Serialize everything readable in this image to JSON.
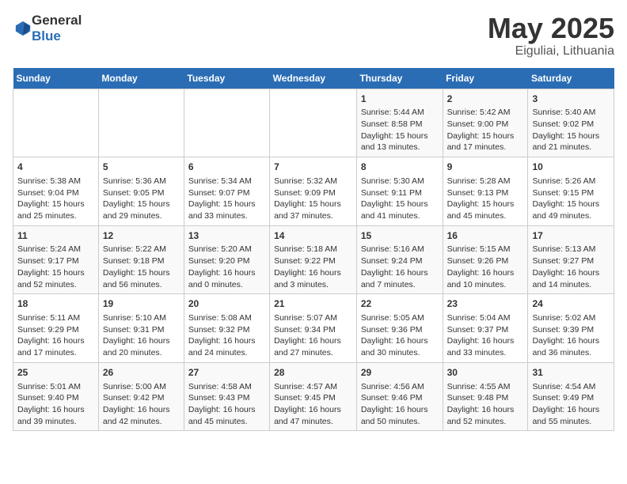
{
  "logo": {
    "general": "General",
    "blue": "Blue"
  },
  "title": "May 2025",
  "subtitle": "Eiguliai, Lithuania",
  "weekdays": [
    "Sunday",
    "Monday",
    "Tuesday",
    "Wednesday",
    "Thursday",
    "Friday",
    "Saturday"
  ],
  "weeks": [
    [
      {
        "day": "",
        "info": ""
      },
      {
        "day": "",
        "info": ""
      },
      {
        "day": "",
        "info": ""
      },
      {
        "day": "",
        "info": ""
      },
      {
        "day": "1",
        "info": "Sunrise: 5:44 AM\nSunset: 8:58 PM\nDaylight: 15 hours\nand 13 minutes."
      },
      {
        "day": "2",
        "info": "Sunrise: 5:42 AM\nSunset: 9:00 PM\nDaylight: 15 hours\nand 17 minutes."
      },
      {
        "day": "3",
        "info": "Sunrise: 5:40 AM\nSunset: 9:02 PM\nDaylight: 15 hours\nand 21 minutes."
      }
    ],
    [
      {
        "day": "4",
        "info": "Sunrise: 5:38 AM\nSunset: 9:04 PM\nDaylight: 15 hours\nand 25 minutes."
      },
      {
        "day": "5",
        "info": "Sunrise: 5:36 AM\nSunset: 9:05 PM\nDaylight: 15 hours\nand 29 minutes."
      },
      {
        "day": "6",
        "info": "Sunrise: 5:34 AM\nSunset: 9:07 PM\nDaylight: 15 hours\nand 33 minutes."
      },
      {
        "day": "7",
        "info": "Sunrise: 5:32 AM\nSunset: 9:09 PM\nDaylight: 15 hours\nand 37 minutes."
      },
      {
        "day": "8",
        "info": "Sunrise: 5:30 AM\nSunset: 9:11 PM\nDaylight: 15 hours\nand 41 minutes."
      },
      {
        "day": "9",
        "info": "Sunrise: 5:28 AM\nSunset: 9:13 PM\nDaylight: 15 hours\nand 45 minutes."
      },
      {
        "day": "10",
        "info": "Sunrise: 5:26 AM\nSunset: 9:15 PM\nDaylight: 15 hours\nand 49 minutes."
      }
    ],
    [
      {
        "day": "11",
        "info": "Sunrise: 5:24 AM\nSunset: 9:17 PM\nDaylight: 15 hours\nand 52 minutes."
      },
      {
        "day": "12",
        "info": "Sunrise: 5:22 AM\nSunset: 9:18 PM\nDaylight: 15 hours\nand 56 minutes."
      },
      {
        "day": "13",
        "info": "Sunrise: 5:20 AM\nSunset: 9:20 PM\nDaylight: 16 hours\nand 0 minutes."
      },
      {
        "day": "14",
        "info": "Sunrise: 5:18 AM\nSunset: 9:22 PM\nDaylight: 16 hours\nand 3 minutes."
      },
      {
        "day": "15",
        "info": "Sunrise: 5:16 AM\nSunset: 9:24 PM\nDaylight: 16 hours\nand 7 minutes."
      },
      {
        "day": "16",
        "info": "Sunrise: 5:15 AM\nSunset: 9:26 PM\nDaylight: 16 hours\nand 10 minutes."
      },
      {
        "day": "17",
        "info": "Sunrise: 5:13 AM\nSunset: 9:27 PM\nDaylight: 16 hours\nand 14 minutes."
      }
    ],
    [
      {
        "day": "18",
        "info": "Sunrise: 5:11 AM\nSunset: 9:29 PM\nDaylight: 16 hours\nand 17 minutes."
      },
      {
        "day": "19",
        "info": "Sunrise: 5:10 AM\nSunset: 9:31 PM\nDaylight: 16 hours\nand 20 minutes."
      },
      {
        "day": "20",
        "info": "Sunrise: 5:08 AM\nSunset: 9:32 PM\nDaylight: 16 hours\nand 24 minutes."
      },
      {
        "day": "21",
        "info": "Sunrise: 5:07 AM\nSunset: 9:34 PM\nDaylight: 16 hours\nand 27 minutes."
      },
      {
        "day": "22",
        "info": "Sunrise: 5:05 AM\nSunset: 9:36 PM\nDaylight: 16 hours\nand 30 minutes."
      },
      {
        "day": "23",
        "info": "Sunrise: 5:04 AM\nSunset: 9:37 PM\nDaylight: 16 hours\nand 33 minutes."
      },
      {
        "day": "24",
        "info": "Sunrise: 5:02 AM\nSunset: 9:39 PM\nDaylight: 16 hours\nand 36 minutes."
      }
    ],
    [
      {
        "day": "25",
        "info": "Sunrise: 5:01 AM\nSunset: 9:40 PM\nDaylight: 16 hours\nand 39 minutes."
      },
      {
        "day": "26",
        "info": "Sunrise: 5:00 AM\nSunset: 9:42 PM\nDaylight: 16 hours\nand 42 minutes."
      },
      {
        "day": "27",
        "info": "Sunrise: 4:58 AM\nSunset: 9:43 PM\nDaylight: 16 hours\nand 45 minutes."
      },
      {
        "day": "28",
        "info": "Sunrise: 4:57 AM\nSunset: 9:45 PM\nDaylight: 16 hours\nand 47 minutes."
      },
      {
        "day": "29",
        "info": "Sunrise: 4:56 AM\nSunset: 9:46 PM\nDaylight: 16 hours\nand 50 minutes."
      },
      {
        "day": "30",
        "info": "Sunrise: 4:55 AM\nSunset: 9:48 PM\nDaylight: 16 hours\nand 52 minutes."
      },
      {
        "day": "31",
        "info": "Sunrise: 4:54 AM\nSunset: 9:49 PM\nDaylight: 16 hours\nand 55 minutes."
      }
    ]
  ]
}
